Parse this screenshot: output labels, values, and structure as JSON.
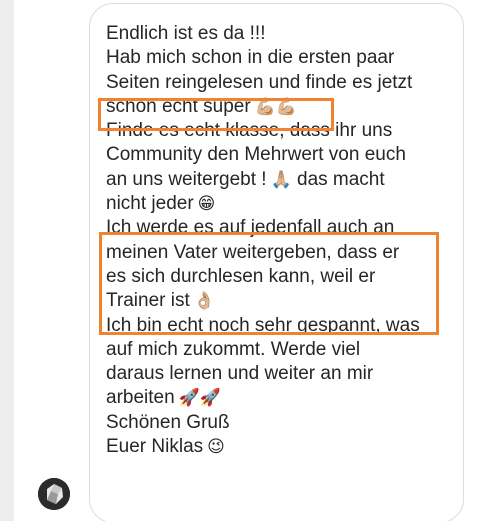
{
  "message": {
    "lines": [
      {
        "text": "Endlich ist es da !!!",
        "emoji": ""
      },
      {
        "text": "Hab mich schon in die ersten paar",
        "emoji": ""
      },
      {
        "text": "Seiten reingelesen und finde es jetzt",
        "emoji": ""
      },
      {
        "text": "schon echt super",
        "emoji": "💪🏼💪🏼"
      },
      {
        "text": "Finde es echt klasse, dass ihr uns",
        "emoji": ""
      },
      {
        "text": "Community den Mehrwert von euch",
        "emoji": ""
      },
      {
        "text": "an uns weitergebt !",
        "emoji": "🙏🏼",
        "suffix": " das macht"
      },
      {
        "text": "nicht jeder",
        "emoji": "😁"
      },
      {
        "text": "Ich werde es auf jedenfall auch an",
        "emoji": ""
      },
      {
        "text": "meinen Vater weitergeben, dass er",
        "emoji": ""
      },
      {
        "text": "es sich durchlesen kann, weil er",
        "emoji": ""
      },
      {
        "text": "Trainer ist",
        "emoji": "👌🏼"
      },
      {
        "text": "Ich bin echt noch sehr gespannt, was",
        "emoji": ""
      },
      {
        "text": "auf mich zukommt. Werde viel",
        "emoji": ""
      },
      {
        "text": "daraus lernen und weiter an mir",
        "emoji": ""
      },
      {
        "text": "arbeiten",
        "emoji": "🚀🚀"
      },
      {
        "text": "Schönen Gruß",
        "emoji": ""
      },
      {
        "text": "Euer Niklas",
        "emoji": "😉"
      }
    ]
  },
  "avatar_icon": "sender-avatar",
  "colors": {
    "highlight": "#f0832f",
    "text": "#262626",
    "bubble_border": "#dcdcdc"
  }
}
